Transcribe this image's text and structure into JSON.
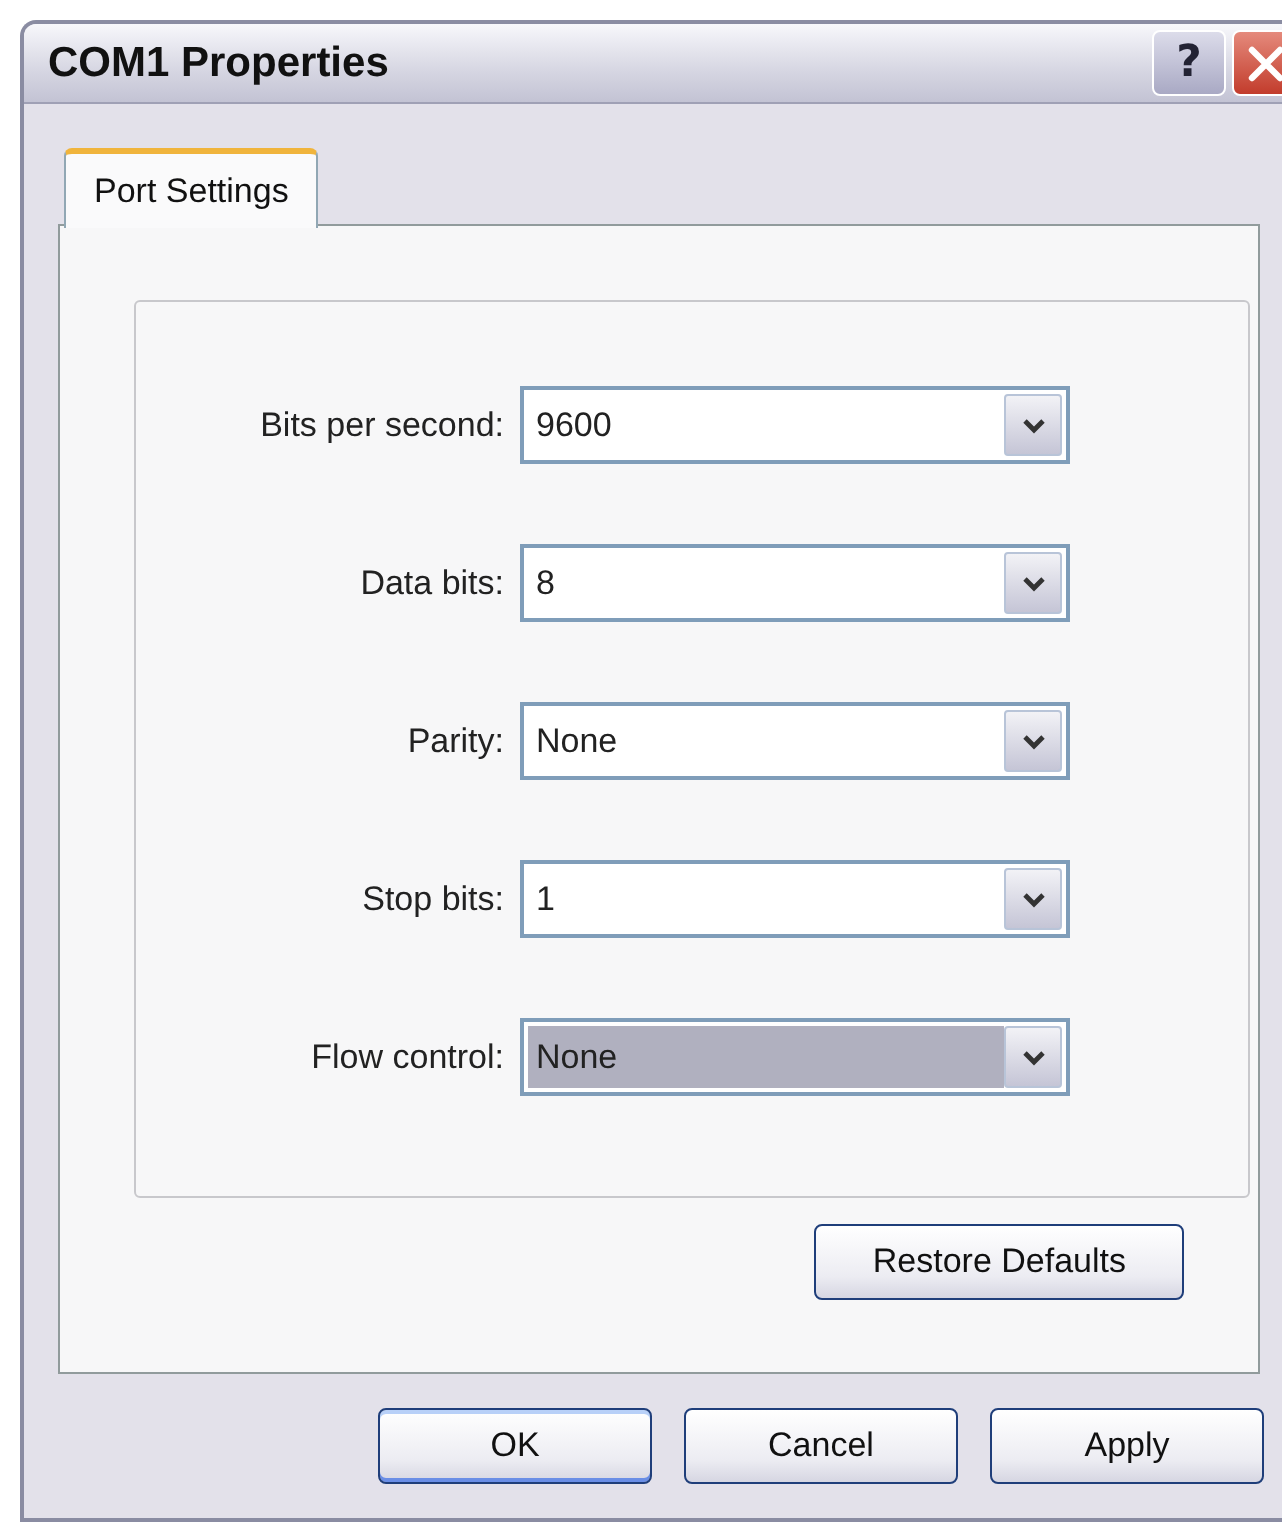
{
  "window": {
    "title": "COM1 Properties"
  },
  "title_buttons": [
    {
      "kind": "help",
      "label": "?"
    },
    {
      "kind": "close"
    }
  ],
  "tabs": [
    {
      "label": "Port Settings",
      "selected": true
    }
  ],
  "fields": [
    {
      "label": "Bits per second:",
      "value": "9600",
      "focused": false
    },
    {
      "label": "Data bits:",
      "value": "8",
      "focused": false
    },
    {
      "label": "Parity:",
      "value": "None",
      "focused": false
    },
    {
      "label": "Stop bits:",
      "value": "1",
      "focused": false
    },
    {
      "label": "Flow control:",
      "value": "None",
      "focused": true
    }
  ],
  "restore_button": "Restore Defaults",
  "buttons": [
    {
      "label": "OK",
      "default": true
    },
    {
      "label": "Cancel",
      "default": false
    },
    {
      "label": "Apply",
      "default": false
    }
  ]
}
